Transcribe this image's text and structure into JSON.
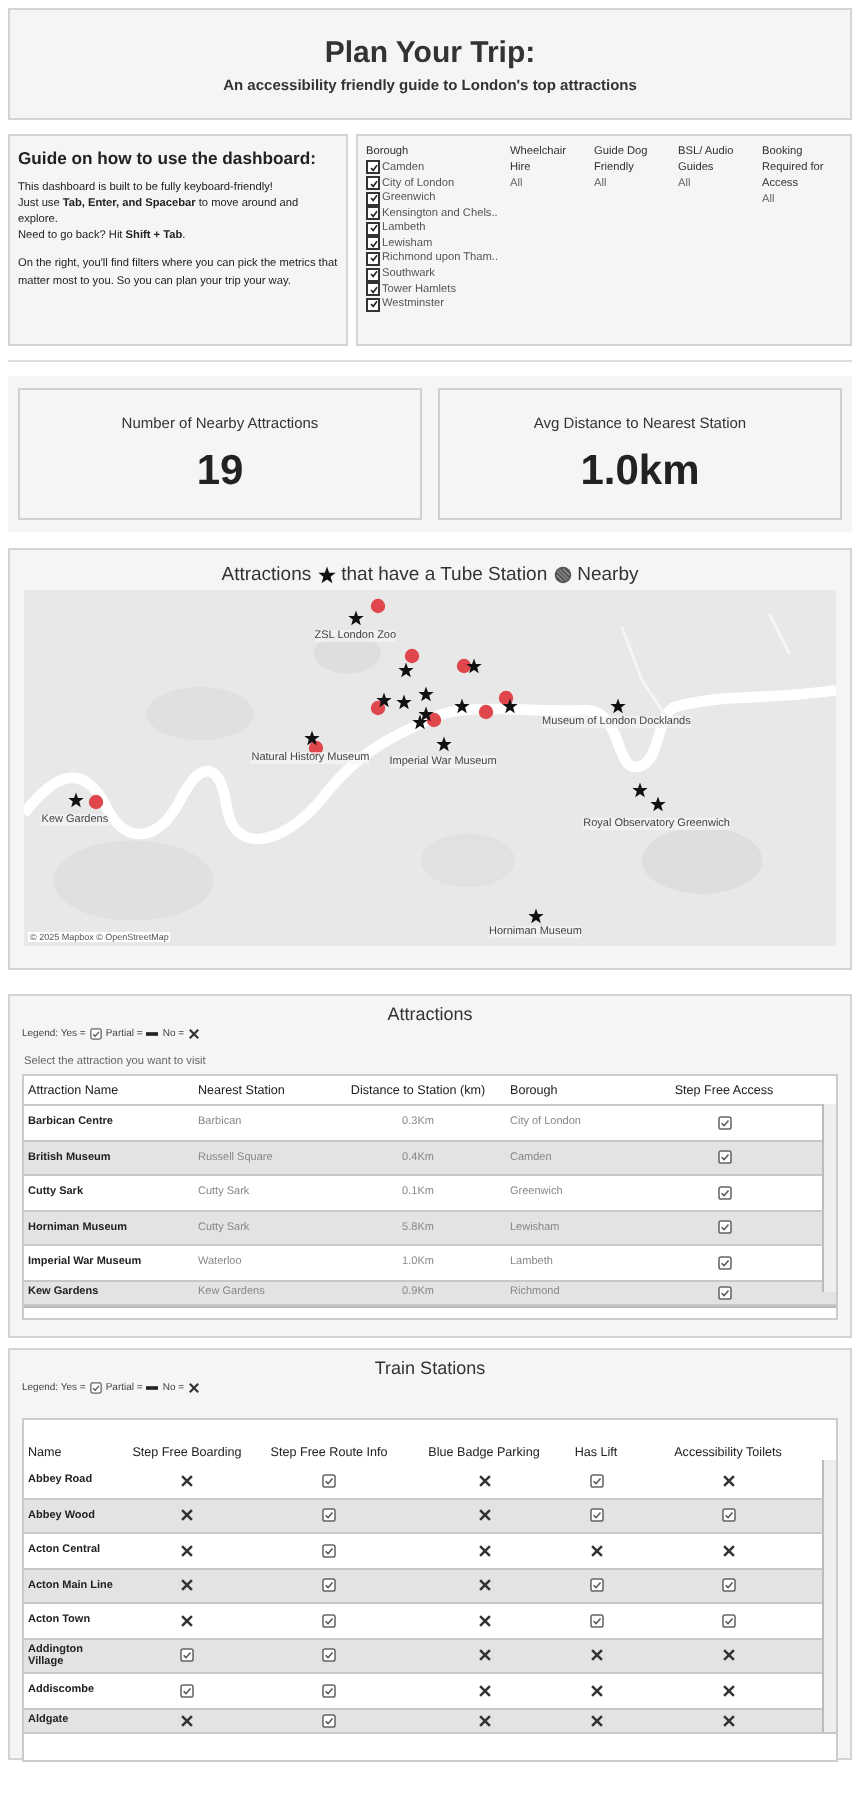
{
  "header": {
    "title": "Plan Your Trip:",
    "subtitle": "An accessibility friendly guide to London's top attractions"
  },
  "guide": {
    "title": "Guide on how to use the dashboard:",
    "paragraphs": [
      "This dashboard is built to be fully keyboard-friendly!\nJust use **Tab, Enter, and Spacebar** to move around and explore.\nNeed to go back? Hit **Shift + Tab**.",
      "On the right, you'll find filters where you can pick the metrics that matter most to you. So you can plan your trip your way."
    ]
  },
  "filters": {
    "borough": {
      "label": "Borough",
      "items": [
        {
          "label": "Camden",
          "checked": true
        },
        {
          "label": "City of London",
          "checked": true
        },
        {
          "label": "Greenwich",
          "checked": true
        },
        {
          "label": "Kensington and Chels..",
          "checked": true
        },
        {
          "label": "Lambeth",
          "checked": true
        },
        {
          "label": "Lewisham",
          "checked": true
        },
        {
          "label": "Richmond upon Tham..",
          "checked": true
        },
        {
          "label": "Southwark",
          "checked": true
        },
        {
          "label": "Tower Hamlets",
          "checked": true
        },
        {
          "label": "Westminster",
          "checked": true
        }
      ]
    },
    "others": [
      {
        "label": "Wheelchair Hire",
        "value": "All"
      },
      {
        "label": "Guide Dog Friendly",
        "value": "All"
      },
      {
        "label": "BSL/ Audio Guides",
        "value": "All"
      },
      {
        "label": "Booking Required for Access",
        "value": "All"
      }
    ]
  },
  "kpis": [
    {
      "label": "Number of Nearby Attractions",
      "value": "19"
    },
    {
      "label": "Avg Distance to Nearest Station",
      "value": "1.0km"
    }
  ],
  "map": {
    "title_parts": [
      "Attractions",
      "that have a Tube Station",
      "Nearby"
    ],
    "labels": [
      "ZSL London Zoo",
      "Natural History Museum",
      "Imperial War Museum",
      "Museum of London Docklands",
      "Royal Observatory Greenwich",
      "Kew Gardens",
      "Horniman Museum"
    ],
    "credit": "© 2025 Mapbox © OpenStreetMap"
  },
  "attractions": {
    "title": "Attractions",
    "legend": [
      "Legend: Yes =",
      "Partial =",
      "No ="
    ],
    "hint": "Select the attraction you want to visit",
    "columns": [
      "Attraction Name",
      "Nearest Station",
      "Distance to Station (km)",
      "Borough",
      "Step Free Access"
    ],
    "rows": [
      {
        "name": "Barbican Centre",
        "station": "Barbican",
        "distance": "0.3Km",
        "borough": "City of London",
        "step_free": true
      },
      {
        "name": "British Museum",
        "station": "Russell Square",
        "distance": "0.4Km",
        "borough": "Camden",
        "step_free": true
      },
      {
        "name": "Cutty Sark",
        "station": "Cutty Sark",
        "distance": "0.1Km",
        "borough": "Greenwich",
        "step_free": true
      },
      {
        "name": "Horniman Museum",
        "station": "Cutty Sark",
        "distance": "5.8Km",
        "borough": "Lewisham",
        "step_free": true
      },
      {
        "name": "Imperial War Museum",
        "station": "Waterloo",
        "distance": "1.0Km",
        "borough": "Lambeth",
        "step_free": true
      },
      {
        "name": "Kew Gardens",
        "station": "Kew Gardens",
        "distance": "0.9Km",
        "borough": "Richmond",
        "step_free": true
      }
    ]
  },
  "stations": {
    "title": "Train Stations",
    "legend": [
      "Legend: Yes =",
      "Partial =",
      "No ="
    ],
    "columns": [
      "Name",
      "Step Free Boarding",
      "Step Free Route Info",
      "Blue Badge Parking",
      "Has Lift",
      "Accessibility Toilets"
    ],
    "rows": [
      {
        "name": "Abbey Road",
        "values": [
          false,
          true,
          false,
          true,
          false
        ]
      },
      {
        "name": "Abbey Wood",
        "values": [
          false,
          true,
          false,
          true,
          true
        ]
      },
      {
        "name": "Acton Central",
        "values": [
          false,
          true,
          false,
          false,
          false
        ]
      },
      {
        "name": "Acton Main Line",
        "values": [
          false,
          true,
          false,
          true,
          true
        ]
      },
      {
        "name": "Acton Town",
        "values": [
          false,
          true,
          false,
          true,
          true
        ]
      },
      {
        "name": "Addington Village",
        "values": [
          true,
          true,
          false,
          false,
          false
        ]
      },
      {
        "name": "Addiscombe",
        "values": [
          true,
          true,
          false,
          false,
          false
        ]
      },
      {
        "name": "Aldgate",
        "values": [
          false,
          true,
          false,
          false,
          false
        ]
      }
    ]
  }
}
